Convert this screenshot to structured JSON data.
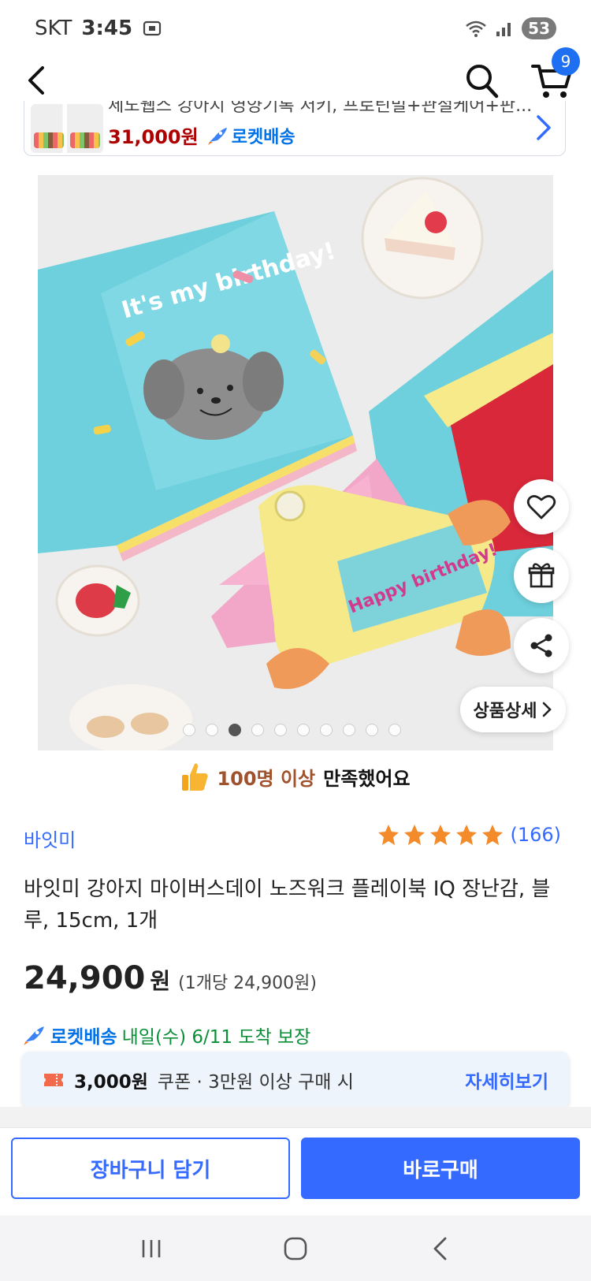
{
  "status_bar": {
    "carrier": "SKT",
    "time": "3:45",
    "battery": "53"
  },
  "header": {
    "cart_badge": "9"
  },
  "mini_banner": {
    "title": "세노웹스 강아지 영양기록 저키, 프로틴밀+관절케어+판...",
    "price": "31,000원",
    "rocket_label": "로켓배송"
  },
  "gallery": {
    "detail_button_label": "상품상세",
    "dot_count": 10,
    "active_dot": 2,
    "image_text_1": "It's my birthday!",
    "image_text_2": "Happy birthday!"
  },
  "satisfaction": {
    "highlight": "100명 이상",
    "rest": "만족했어요"
  },
  "product": {
    "brand": "바잇미",
    "rating_stars": 5,
    "review_count": "(166)",
    "title": "바잇미 강아지 마이버스데이 노즈워크 플레이북 IQ 장난감, 블루, 15cm, 1개",
    "price": "24,900",
    "price_unit": "원",
    "unit_price": "(1개당 24,900원)"
  },
  "delivery": {
    "rocket_label": "로켓배송",
    "arrival": "내일(수) 6/11 도착 보장"
  },
  "coupon": {
    "amount": "3,000원",
    "desc": "쿠폰 · 3만원 이상 구매 시",
    "more": "자세히보기"
  },
  "actions": {
    "cart_label": "장바구니 담기",
    "buy_label": "바로구매"
  },
  "colors": {
    "accent": "#346aff",
    "rocket": "#0073e9",
    "price_red": "#ae0000",
    "arrival_green": "#0a8f36"
  }
}
